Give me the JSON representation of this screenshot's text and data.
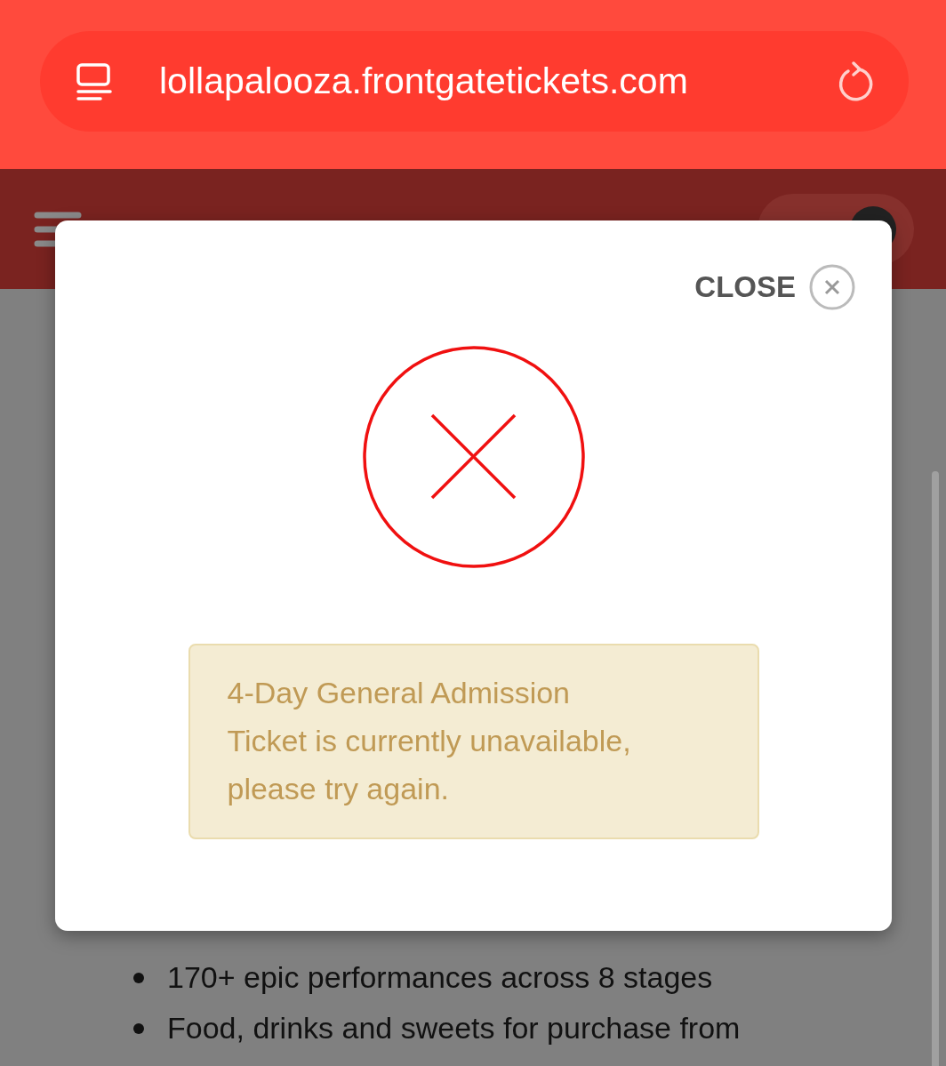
{
  "browser": {
    "url": "lollapalooza.frontgatetickets.com"
  },
  "page": {
    "bullets": [
      "170+ epic performances across 8 stages",
      "Food, drinks and sweets for purchase from"
    ]
  },
  "modal": {
    "close_label": "CLOSE",
    "kind": "error",
    "message": "4-Day General Admission Ticket is currently unavailable, please try again."
  }
}
